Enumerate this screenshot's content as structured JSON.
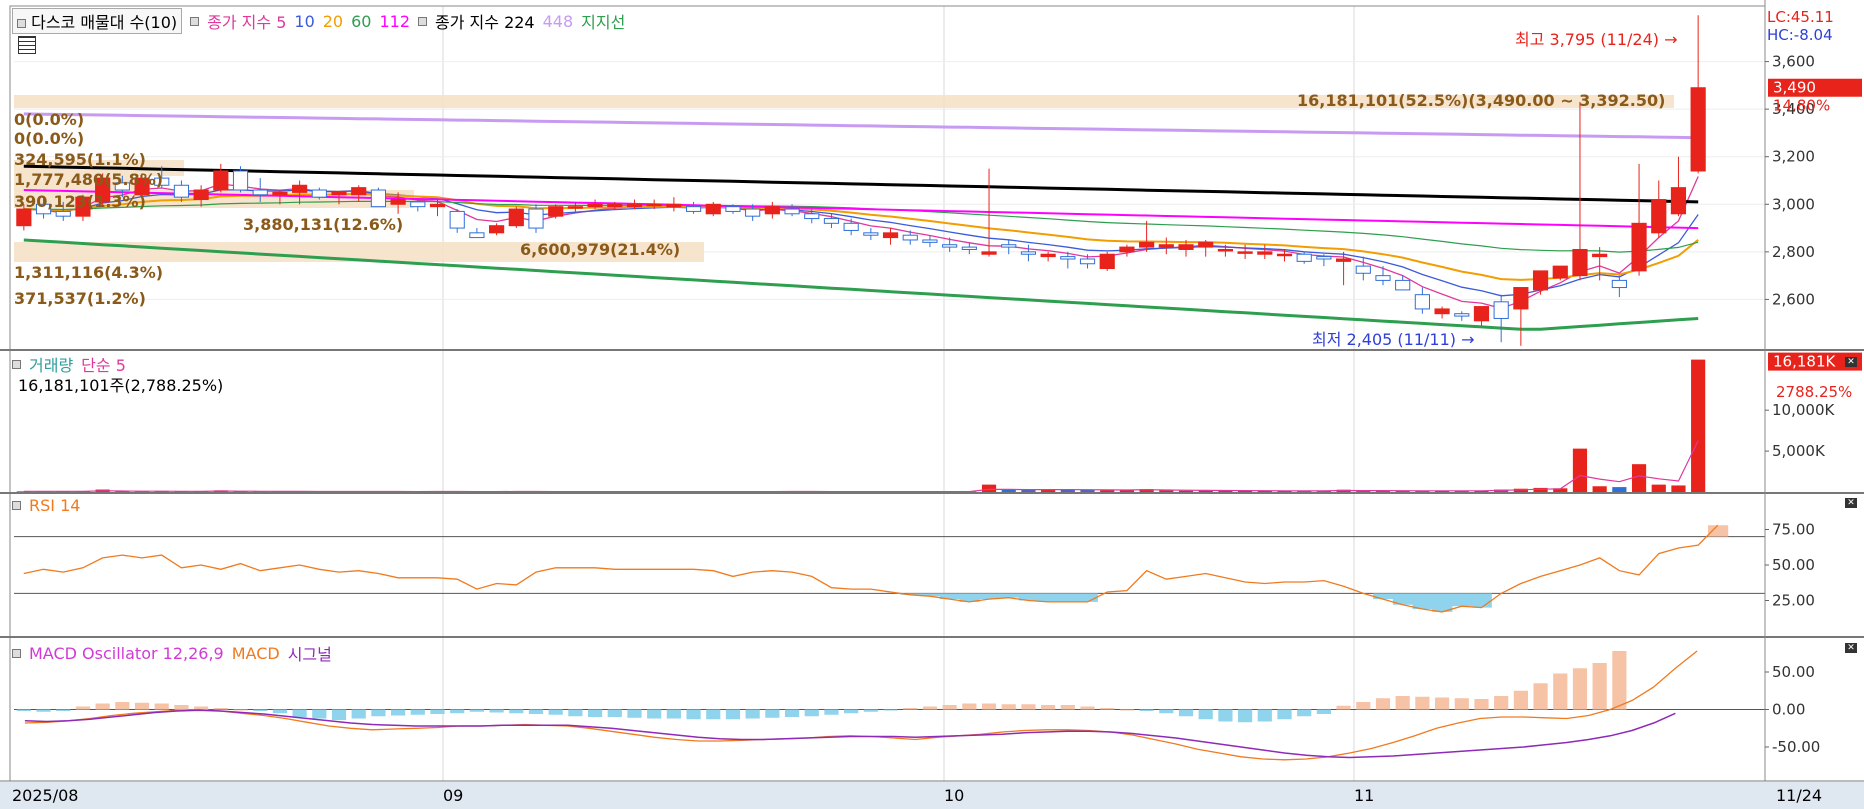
{
  "colors": {
    "up": "#e8231b",
    "down": "#2f6fd8",
    "ma5": "#e0389c",
    "ma10": "#3b5bdb",
    "ma20": "#f29d00",
    "ma60": "#2e9e4f",
    "ma112": "#ff00ff",
    "ma224": "#000000",
    "ma448": "#c79bf2",
    "support": "#2e9e4f",
    "rsi": "#f07a1f",
    "macd": "#f07a1f",
    "signal": "#8e2ab8"
  },
  "price_panel": {
    "legend": {
      "volume_profile": "다스코 매물대 수(10)",
      "ma_prefix": "종가 지수 5",
      "ma10": "10",
      "ma20": "20",
      "ma60": "60",
      "ma112": "112",
      "ma224_prefix": "종가 지수 224",
      "ma448": "448",
      "support": "지지선"
    },
    "high_label": "최고 3,795 (11/24)",
    "low_label": "최저 2,405 (11/11)",
    "lc_label": "LC:45.11",
    "hc_label": "HC:-8.04",
    "last_price_tag": "3,490",
    "change_tag": "14.80%",
    "y_ticks": [
      "3,600",
      "3,400",
      "3,200",
      "3,000",
      "2,800",
      "2,600"
    ],
    "volume_profile": [
      "16,181,101(52.5%)(3,490.00 ~ 3,392.50)",
      "0(0.0%)",
      "0(0.0%)",
      "324,595(1.1%)",
      "1,777,480(5.8%)",
      "390,123(1.3%)",
      "3,880,131(12.6%)",
      "6,600,979(21.4%)",
      "1,311,116(4.3%)",
      "371,537(1.2%)"
    ]
  },
  "volume_panel": {
    "legend": {
      "title": "거래량",
      "ma": "단순 5"
    },
    "summary": "16,181,101주(2,788.25%)",
    "tag_value": "16,181K",
    "tag_pct": "2788.25%",
    "y_ticks": [
      "10,000K",
      "5,000K"
    ]
  },
  "rsi_panel": {
    "legend": "RSI 14",
    "y_ticks": [
      "75.00",
      "50.00",
      "25.00"
    ]
  },
  "macd_panel": {
    "legend": {
      "osc": "MACD Oscillator 12,26,9",
      "macd": "MACD",
      "signal": "시그널"
    },
    "y_ticks": [
      "50.00",
      "0.00",
      "-50.00"
    ]
  },
  "x_axis": {
    "labels": [
      "2025/08",
      "09",
      "10",
      "11"
    ],
    "last_label": "11/24"
  },
  "chart_data": {
    "type": "candlestick",
    "x_range": "2025/08 ~ 2025/11/24",
    "price_ylim": [
      2400,
      3800
    ],
    "candles": [
      [
        2910,
        3000,
        2890,
        2980
      ],
      [
        3000,
        3030,
        2940,
        2960
      ],
      [
        2970,
        3010,
        2930,
        2950
      ],
      [
        2950,
        3040,
        2930,
        3030
      ],
      [
        3010,
        3130,
        2990,
        3110
      ],
      [
        3090,
        3120,
        3030,
        3060
      ],
      [
        3040,
        3130,
        3030,
        3110
      ],
      [
        3110,
        3160,
        3070,
        3080
      ],
      [
        3080,
        3100,
        3010,
        3030
      ],
      [
        3020,
        3080,
        2990,
        3060
      ],
      [
        3060,
        3170,
        3050,
        3140
      ],
      [
        3140,
        3160,
        3050,
        3060
      ],
      [
        3060,
        3110,
        3010,
        3040
      ],
      [
        3040,
        3060,
        3000,
        3050
      ],
      [
        3050,
        3100,
        3000,
        3080
      ],
      [
        3060,
        3070,
        3020,
        3030
      ],
      [
        3040,
        3050,
        3000,
        3050
      ],
      [
        3040,
        3080,
        3010,
        3070
      ],
      [
        3060,
        3070,
        2990,
        2990
      ],
      [
        3000,
        3050,
        2960,
        3020
      ],
      [
        3010,
        3020,
        2970,
        2990
      ],
      [
        2990,
        3020,
        2950,
        3000
      ],
      [
        2970,
        2980,
        2880,
        2900
      ],
      [
        2880,
        2900,
        2860,
        2860
      ],
      [
        2880,
        2920,
        2870,
        2910
      ],
      [
        2910,
        2990,
        2900,
        2980
      ],
      [
        2980,
        3000,
        2880,
        2900
      ],
      [
        2950,
        3000,
        2940,
        2990
      ],
      [
        2990,
        3010,
        2970,
        2990
      ],
      [
        2990,
        3020,
        2980,
        3000
      ],
      [
        2990,
        3010,
        2980,
        3000
      ],
      [
        2990,
        3020,
        2980,
        3000
      ],
      [
        3000,
        3020,
        2980,
        3000
      ],
      [
        2990,
        3030,
        2970,
        3000
      ],
      [
        2990,
        3010,
        2960,
        2970
      ],
      [
        2960,
        3010,
        2950,
        3000
      ],
      [
        2990,
        3000,
        2960,
        2970
      ],
      [
        2980,
        3000,
        2930,
        2950
      ],
      [
        2960,
        3010,
        2940,
        2990
      ],
      [
        2980,
        3000,
        2950,
        2960
      ],
      [
        2960,
        2980,
        2920,
        2940
      ],
      [
        2940,
        2960,
        2900,
        2920
      ],
      [
        2920,
        2940,
        2870,
        2890
      ],
      [
        2880,
        2900,
        2850,
        2870
      ],
      [
        2860,
        2900,
        2830,
        2880
      ],
      [
        2870,
        2890,
        2830,
        2850
      ],
      [
        2850,
        2870,
        2820,
        2840
      ],
      [
        2830,
        2860,
        2800,
        2820
      ],
      [
        2820,
        2840,
        2790,
        2810
      ],
      [
        2790,
        3150,
        2780,
        2800
      ],
      [
        2830,
        2850,
        2790,
        2820
      ],
      [
        2800,
        2830,
        2760,
        2790
      ],
      [
        2780,
        2800,
        2760,
        2790
      ],
      [
        2780,
        2800,
        2730,
        2770
      ],
      [
        2770,
        2790,
        2730,
        2750
      ],
      [
        2730,
        2800,
        2720,
        2790
      ],
      [
        2800,
        2830,
        2780,
        2820
      ],
      [
        2820,
        2930,
        2800,
        2840
      ],
      [
        2820,
        2860,
        2790,
        2830
      ],
      [
        2810,
        2850,
        2780,
        2830
      ],
      [
        2820,
        2850,
        2780,
        2840
      ],
      [
        2810,
        2830,
        2780,
        2810
      ],
      [
        2800,
        2830,
        2770,
        2800
      ],
      [
        2790,
        2830,
        2770,
        2800
      ],
      [
        2790,
        2810,
        2760,
        2790
      ],
      [
        2790,
        2800,
        2750,
        2760
      ],
      [
        2780,
        2790,
        2740,
        2770
      ],
      [
        2760,
        2800,
        2660,
        2770
      ],
      [
        2740,
        2780,
        2680,
        2710
      ],
      [
        2700,
        2740,
        2660,
        2680
      ],
      [
        2680,
        2700,
        2640,
        2640
      ],
      [
        2620,
        2650,
        2540,
        2560
      ],
      [
        2540,
        2570,
        2520,
        2560
      ],
      [
        2540,
        2550,
        2510,
        2530
      ],
      [
        2510,
        2560,
        2490,
        2570
      ],
      [
        2590,
        2620,
        2420,
        2520
      ],
      [
        2560,
        2640,
        2405,
        2650
      ],
      [
        2640,
        2700,
        2620,
        2720
      ],
      [
        2690,
        2740,
        2680,
        2740
      ],
      [
        2700,
        3430,
        2680,
        2810
      ],
      [
        2780,
        2820,
        2680,
        2790
      ],
      [
        2680,
        2700,
        2610,
        2650
      ],
      [
        2720,
        3170,
        2700,
        2920
      ],
      [
        2880,
        3100,
        2860,
        3020
      ],
      [
        2960,
        3200,
        2950,
        3070
      ],
      [
        3140,
        3795,
        3130,
        3490
      ]
    ],
    "ma_series_names": [
      "5",
      "10",
      "20",
      "60",
      "112",
      "224",
      "448",
      "지지선"
    ],
    "volume_unit": "K shares",
    "volume_ylim": [
      0,
      16500
    ],
    "volume": [
      80,
      60,
      100,
      70,
      300,
      60,
      50,
      80,
      70,
      60,
      200,
      60,
      50,
      60,
      60,
      50,
      50,
      60,
      60,
      50,
      50,
      60,
      60,
      50,
      50,
      60,
      60,
      50,
      50,
      50,
      50,
      50,
      50,
      50,
      50,
      50,
      50,
      50,
      60,
      60,
      60,
      50,
      50,
      50,
      50,
      50,
      50,
      50,
      50,
      900,
      300,
      250,
      300,
      280,
      260,
      220,
      200,
      350,
      180,
      160,
      150,
      150,
      140,
      140,
      120,
      120,
      130,
      280,
      160,
      150,
      150,
      120,
      130,
      140,
      160,
      300,
      400,
      500,
      450,
      5300,
      700,
      600,
      3400,
      900,
      800,
      16181
    ],
    "rsi_ylim": [
      0,
      100
    ],
    "rsi_levels": [
      70,
      30
    ],
    "rsi": [
      44,
      47,
      45,
      48,
      55,
      57,
      55,
      57,
      48,
      50,
      47,
      51,
      46,
      48,
      50,
      47,
      45,
      46,
      44,
      41,
      41,
      41,
      40,
      33,
      37,
      36,
      45,
      48,
      48,
      48,
      47,
      47,
      47,
      47,
      47,
      46,
      42,
      45,
      46,
      45,
      42,
      34,
      33,
      33,
      31,
      29,
      28,
      26,
      24,
      26,
      27,
      25,
      24,
      24,
      24,
      31,
      32,
      46,
      40,
      42,
      44,
      41,
      38,
      37,
      38,
      38,
      39,
      35,
      30,
      26,
      22,
      19,
      17,
      21,
      20,
      30,
      37,
      42,
      46,
      50,
      55,
      46,
      43,
      58,
      62,
      64,
      78
    ],
    "macd_ylim": [
      -90,
      90
    ],
    "macd_osc": [
      -2,
      -3,
      -2,
      4,
      8,
      10,
      9,
      8,
      6,
      4,
      2,
      0,
      -2,
      -5,
      -10,
      -12,
      -14,
      -12,
      -9,
      -8,
      -7,
      -6,
      -5,
      -3,
      -4,
      -5,
      -6,
      -7,
      -9,
      -10,
      -10,
      -11,
      -12,
      -12,
      -13,
      -13,
      -13,
      -12,
      -11,
      -10,
      -9,
      -7,
      -5,
      -3,
      -1,
      2,
      4,
      6,
      8,
      8,
      7,
      7,
      6,
      6,
      4,
      2,
      0,
      -2,
      -5,
      -9,
      -13,
      -16,
      -17,
      -16,
      -13,
      -9,
      -6,
      5,
      10,
      15,
      18,
      17,
      16,
      15,
      14,
      18,
      25,
      35,
      48,
      55,
      62,
      78
    ],
    "macd": [
      -18,
      -17,
      -15,
      -12,
      -8,
      -5,
      -3,
      -1,
      0,
      -2,
      -5,
      -8,
      -12,
      -17,
      -22,
      -25,
      -27,
      -26,
      -25,
      -24,
      -22,
      -22,
      -21,
      -20,
      -21,
      -22,
      -25,
      -29,
      -33,
      -37,
      -40,
      -42,
      -42,
      -41,
      -40,
      -39,
      -38,
      -36,
      -35,
      -36,
      -38,
      -40,
      -37,
      -35,
      -33,
      -30,
      -28,
      -27,
      -27,
      -28,
      -30,
      -34,
      -40,
      -46,
      -53,
      -58,
      -63,
      -66,
      -67,
      -66,
      -63,
      -58,
      -52,
      -44,
      -35,
      -25,
      -18,
      -12,
      -10,
      -10,
      -11,
      -12,
      -8,
      0,
      12,
      30,
      55,
      78
    ],
    "signal": [
      -15,
      -16,
      -15,
      -13,
      -10,
      -7,
      -4,
      -2,
      -1,
      -2,
      -4,
      -6,
      -9,
      -12,
      -15,
      -18,
      -20,
      -21,
      -22,
      -22,
      -22,
      -22,
      -21,
      -21,
      -21,
      -21,
      -23,
      -25,
      -28,
      -31,
      -34,
      -37,
      -39,
      -40,
      -40,
      -39,
      -38,
      -37,
      -36,
      -36,
      -36,
      -37,
      -36,
      -35,
      -34,
      -33,
      -31,
      -30,
      -29,
      -29,
      -30,
      -32,
      -35,
      -38,
      -42,
      -46,
      -50,
      -54,
      -58,
      -61,
      -63,
      -64,
      -63,
      -62,
      -60,
      -58,
      -56,
      -54,
      -52,
      -50,
      -47,
      -44,
      -40,
      -35,
      -28,
      -18,
      -5
    ]
  }
}
